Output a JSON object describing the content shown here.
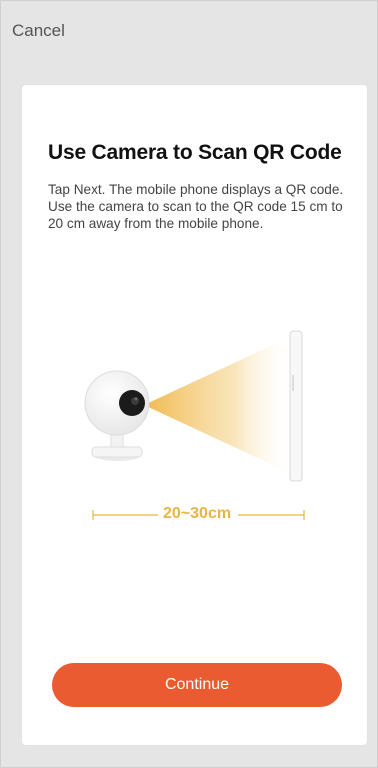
{
  "header": {
    "cancel_label": "Cancel"
  },
  "card": {
    "title": "Use Camera to Scan QR Code",
    "description": "Tap Next. The mobile phone displays a QR code. Use the camera to scan to the QR code 15 cm to 20 cm away from the mobile phone.",
    "distance_label": "20~30cm",
    "continue_label": "Continue"
  },
  "colors": {
    "accent": "#ea5b32",
    "beam": "#f2c15a",
    "distance": "#e8b543"
  },
  "icons": [
    "camera-icon",
    "phone-icon",
    "scan-beam-icon"
  ]
}
